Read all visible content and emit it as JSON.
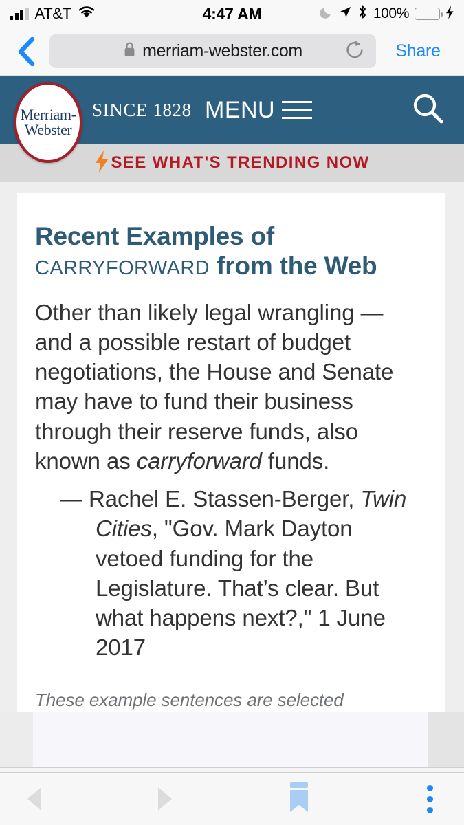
{
  "status_bar": {
    "carrier": "AT&T",
    "time": "4:47 AM",
    "battery_percent": "100%",
    "icons": [
      "signal-bars-icon",
      "wifi-icon",
      "moon-icon",
      "location-arrow-icon",
      "bluetooth-icon",
      "battery-icon",
      "charging-bolt-icon"
    ],
    "battery_color": "#4cd964"
  },
  "browser": {
    "back_label": "back-chevron-icon",
    "url": "merriam-webster.com",
    "lock_icon": "lock-icon",
    "reload_icon": "reload-icon",
    "share_label": "Share",
    "share_color": "#1d8bf7"
  },
  "site_header": {
    "logo_line1": "Merriam-",
    "logo_line2": "Webster",
    "since": "SINCE 1828",
    "menu_label": "MENU",
    "search_icon": "search-icon",
    "background_color": "#2d6080",
    "logo_ring_color": "#a31f29"
  },
  "trending": {
    "label": "SEE WHAT'S TRENDING NOW",
    "bolt_icon": "lightning-bolt-icon",
    "text_color": "#b41923",
    "background_color": "#d8d8d8"
  },
  "content": {
    "title_part1": "Recent Examples of",
    "title_word": "CARRYFORWARD",
    "title_part2": "from the Web",
    "title_color": "#2e5c77",
    "example_before_italic": "Other than likely legal wrangling — and a possible restart of budget negotiations, the House and Senate may have to fund their business through their reserve funds, also known as ",
    "example_italic": "carryforward",
    "example_after_italic": " funds.",
    "attribution_dash": "—",
    "attribution_author": "Rachel E. Stassen-Berger, ",
    "attribution_source": "Twin Cities",
    "attribution_rest": ", \"Gov. Mark Dayton vetoed funding for the Legislature. That’s clear. But what happens next?,\" 1 June 2017",
    "disclaimer": "These example sentences are selected automatically from various online news sources to reflect current usage of the word 'carryforward.' Views expressed in"
  },
  "bottom_bar": {
    "back_icon": "back-triangle-icon",
    "forward_icon": "forward-triangle-icon",
    "bookmark_icon": "bookmark-icon",
    "more_icon": "more-vertical-dots-icon",
    "bookmark_color": "#a8cef5",
    "more_color": "#2187f0"
  }
}
